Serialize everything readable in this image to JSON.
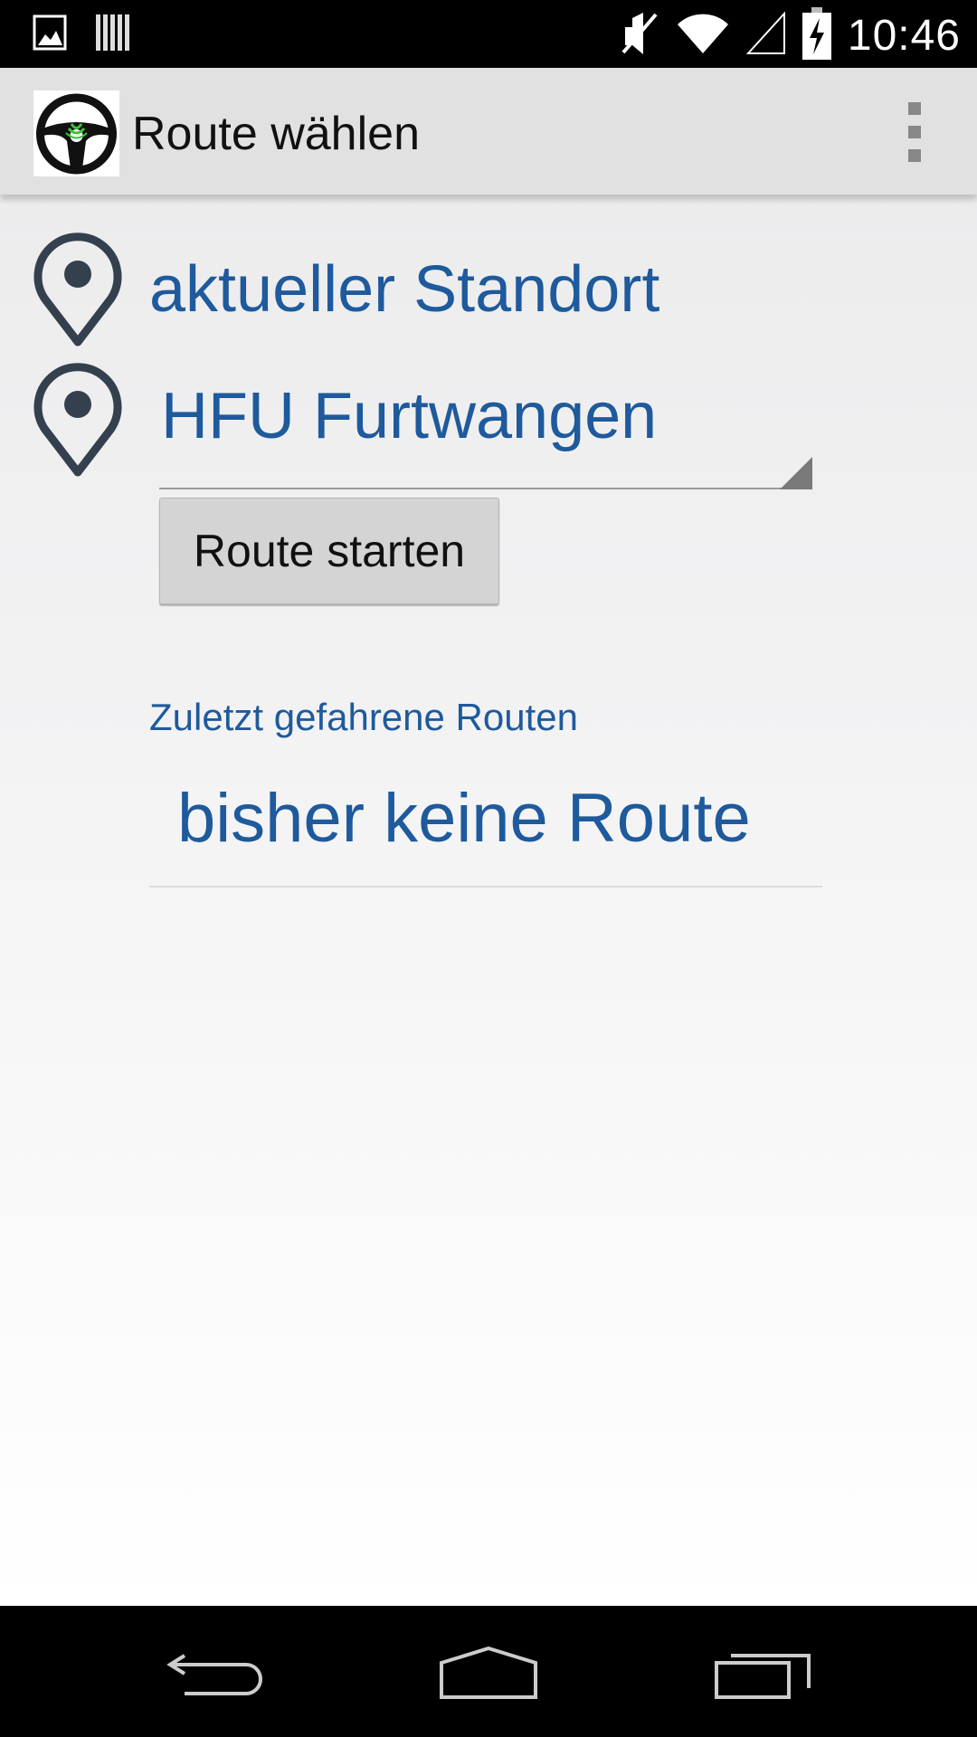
{
  "status_bar": {
    "time": "10:46",
    "left_icons": [
      "image-notification-icon",
      "barcode-notification-icon"
    ],
    "right_icons": [
      "mute-icon",
      "wifi-icon",
      "signal-icon",
      "battery-charging-icon"
    ]
  },
  "action_bar": {
    "title": "Route wählen",
    "app_icon": "steering-wheel-icon",
    "menu_icon": "overflow-menu-icon"
  },
  "route": {
    "origin": "aktueller Standort",
    "destination": "HFU Furtwangen",
    "start_button": "Route starten"
  },
  "recent": {
    "header": "Zuletzt gefahrene Routen",
    "items": [
      "bisher keine Route"
    ]
  },
  "colors": {
    "accent_text": "#1e5a9c",
    "action_bar": "#e1e1e1",
    "pin": "#35404f",
    "wheel_signal": "#3fc23a"
  },
  "nav_bar": {
    "icons": [
      "back-icon",
      "home-icon",
      "recent-apps-icon"
    ]
  }
}
